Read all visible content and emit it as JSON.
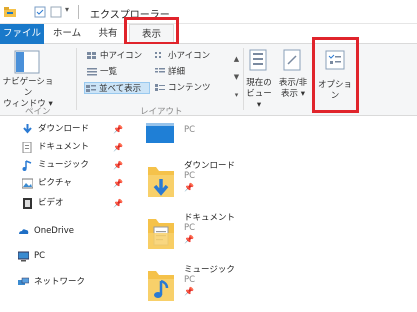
{
  "window": {
    "title": "エクスプローラー"
  },
  "tabs": {
    "file": "ファイル",
    "home": "ホーム",
    "share": "共有",
    "view": "表示"
  },
  "ribbon": {
    "pane_group": {
      "nav_pane_line1": "ナビゲーション",
      "nav_pane_line2": "ウィンドウ ▾",
      "label": "ペイン"
    },
    "layout_group": {
      "label": "レイアウト",
      "items": [
        "中アイコン",
        "小アイコン",
        "一覧",
        "詳細",
        "並べて表示",
        "コンテンツ"
      ]
    },
    "current_view": {
      "line1": "現在の",
      "line2": "ビュー ▾"
    },
    "show_hide": {
      "line1": "表示/非",
      "line2": "表示 ▾"
    },
    "options": {
      "label": "オプション"
    }
  },
  "nav_pane": {
    "pin_glyph": "📌",
    "items": [
      {
        "label": "ダウンロード",
        "icon": "download-arrow-icon"
      },
      {
        "label": "ドキュメント",
        "icon": "document-icon"
      },
      {
        "label": "ミュージック",
        "icon": "music-note-icon"
      },
      {
        "label": "ピクチャ",
        "icon": "picture-icon"
      },
      {
        "label": "ビデオ",
        "icon": "video-icon"
      },
      {
        "label": "OneDrive",
        "icon": "cloud-icon"
      },
      {
        "label": "PC",
        "icon": "pc-icon"
      },
      {
        "label": "ネットワーク",
        "icon": "network-icon"
      }
    ]
  },
  "content": {
    "items": [
      {
        "name": "",
        "sub": "PC"
      },
      {
        "name": "ダウンロード",
        "sub": "PC"
      },
      {
        "name": "ドキュメント",
        "sub": "PC"
      },
      {
        "name": "ミュージック",
        "sub": "PC"
      }
    ]
  },
  "colors": {
    "accent": "#1979ca",
    "highlight": "#e0242b",
    "folder": "#f5c24a"
  }
}
